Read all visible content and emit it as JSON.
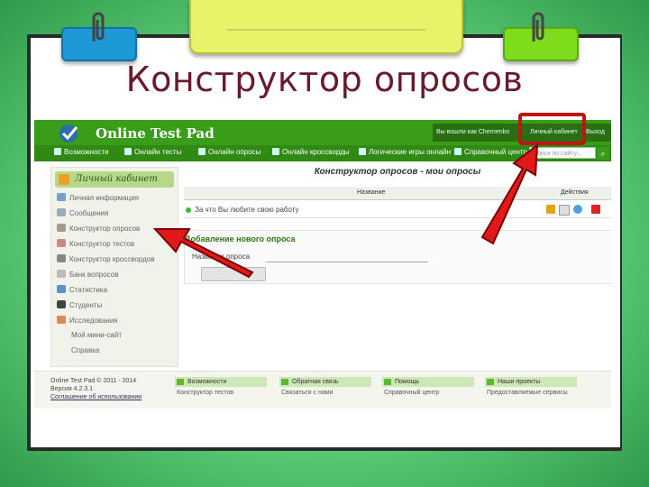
{
  "slide_title": "Конструктор опросов",
  "site": {
    "brand": "Online Test Pad",
    "login_text": "Вы вошли как Chernenko",
    "cabinet_link": "Личный кабинет",
    "logout_link": "Выход",
    "nav": [
      "Возможности",
      "Онлайн тесты",
      "Онлайн опросы",
      "Онлайн кроссворды",
      "Логические игры онлайн",
      "Справочный центр"
    ],
    "search_placeholder": "Поиск по сайту..."
  },
  "sidebar": {
    "header": "Личный кабинет",
    "items": [
      {
        "label": "Личная информация",
        "icon": "id-card-icon"
      },
      {
        "label": "Сообщения",
        "icon": "envelope-icon"
      },
      {
        "label": "Конструктор опросов",
        "icon": "survey-icon"
      },
      {
        "label": "Конструктор тестов",
        "icon": "test-icon"
      },
      {
        "label": "Конструктор кроссвордов",
        "icon": "crossword-icon"
      },
      {
        "label": "Банк вопросов",
        "icon": "question-bank-icon"
      },
      {
        "label": "Статистика",
        "icon": "statistics-icon"
      },
      {
        "label": "Студенты",
        "icon": "students-icon"
      },
      {
        "label": "Исследования",
        "icon": "research-icon"
      },
      {
        "label": "Мой мини-сайт",
        "icon": ""
      },
      {
        "label": "Справка",
        "icon": ""
      }
    ]
  },
  "main": {
    "title": "Конструктор опросов - мои опросы",
    "col_name": "Название",
    "col_actions": "Действия",
    "row_text": "За что Вы любите свою работу",
    "new_title": "Добавление нового опроса",
    "new_label": "Название опроса"
  },
  "footer": {
    "copyright": "Online Test Pad © 2011 - 2014",
    "version": "Версия 4.2.3.1",
    "agreement": "Соглашение об использовании",
    "columns": [
      {
        "head": "Возможности",
        "link": "Конструктор тестов"
      },
      {
        "head": "Обратная связь",
        "link": "Связаться с нами"
      },
      {
        "head": "Помощь",
        "link": "Справочный центр"
      },
      {
        "head": "Наши проекты",
        "link": "Предоставляемые сервисы"
      }
    ]
  },
  "colors": {
    "accent_green": "#3a9d1a",
    "annotation_red": "#c01414",
    "title": "#6a1a2a"
  }
}
